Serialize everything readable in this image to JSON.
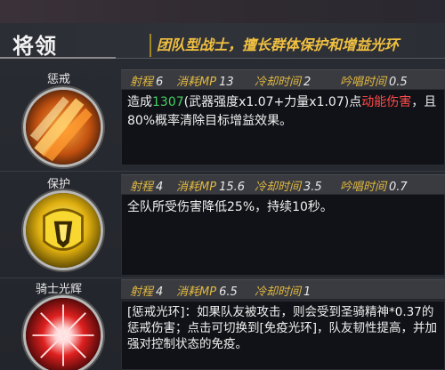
{
  "header": {
    "title": "将领",
    "role_desc": "团队型战士，擅长群体保护和增益光环"
  },
  "skills": [
    {
      "name": "惩戒",
      "icon": "fire-slash-icon",
      "range_label": "射程",
      "range": "6",
      "mp_label": "消耗MP",
      "mp": "13",
      "cd_label": "冷却时间",
      "cd": "2",
      "cast_label": "吟唱时间",
      "cast": "0.5",
      "desc_pre": "造成",
      "desc_num": "1307",
      "desc_mid": "(武器强度x1.07+力量x1.07)点",
      "desc_red": "动能伤害",
      "desc_post": "，且80%概率清除目标增益效果。"
    },
    {
      "name": "保护",
      "icon": "golden-shield-icon",
      "range_label": "射程",
      "range": "4",
      "mp_label": "消耗MP",
      "mp": "15.6",
      "cd_label": "冷却时间",
      "cd": "3.5",
      "cast_label": "吟唱时间",
      "cast": "0.7",
      "desc": "全队所受伤害降低25%，持续10秒。"
    },
    {
      "name": "骑士光辉",
      "icon": "red-burst-icon",
      "range_label": "射程",
      "range": "4",
      "mp_label": "消耗MP",
      "mp": "6.5",
      "cd_label": "冷却时间",
      "cd": "1",
      "desc": "[惩戒光环]：如果队友被攻击，则会受到圣骑精神*0.37的惩戒伤害；点击可切换到[免疫光环]，队友韧性提高，并加强对控制状态的免疫。"
    }
  ],
  "colors": {
    "accent": "#f0c040",
    "stat_label": "#e0b840",
    "number_green": "#44d060",
    "damage_red": "#ff4a4a"
  }
}
